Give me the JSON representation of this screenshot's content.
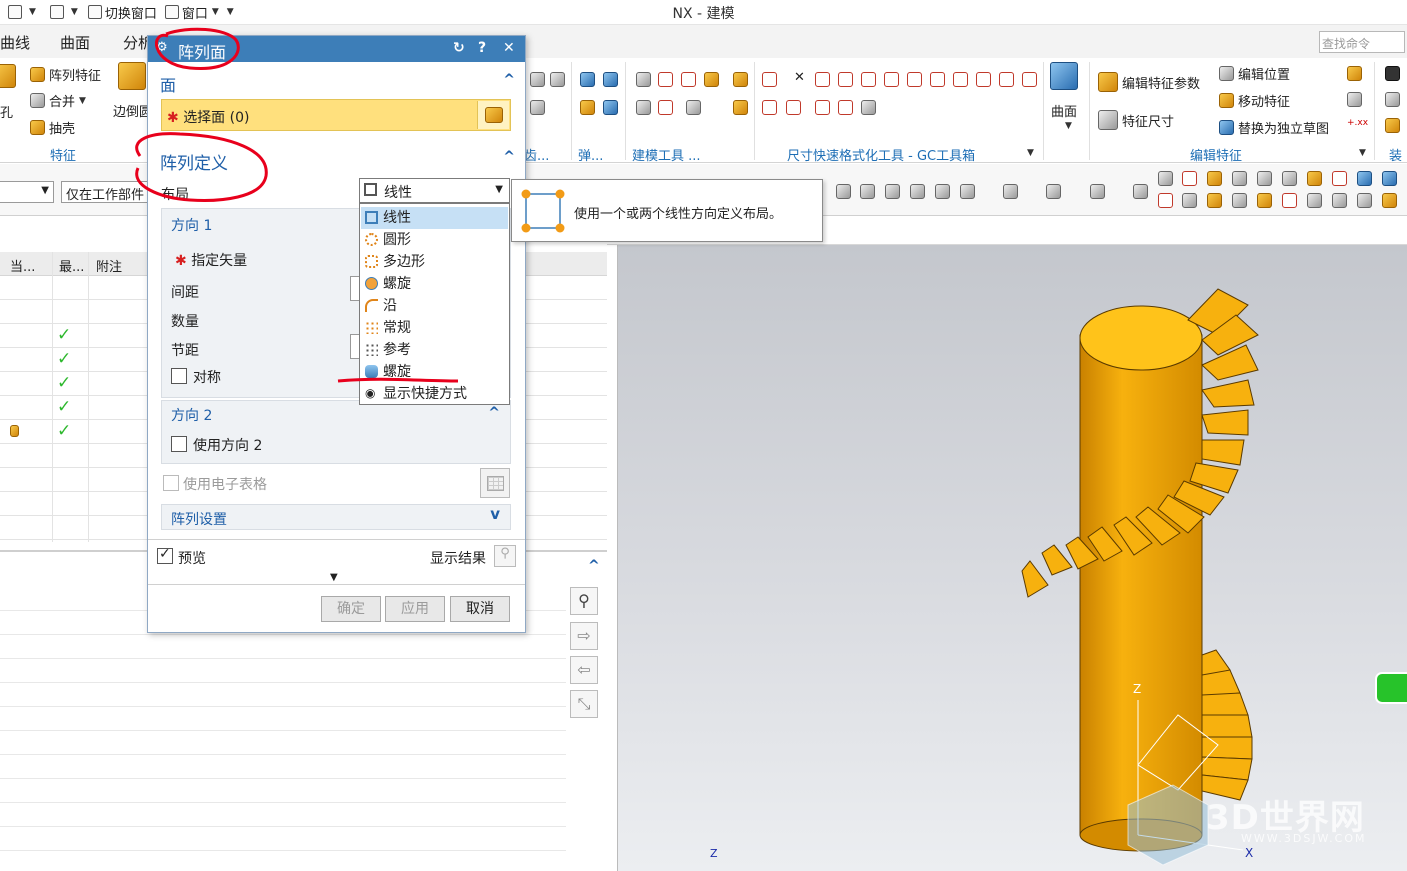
{
  "window": {
    "title": "NX - 建模"
  },
  "quick_access": {
    "switch_window": "切换窗口",
    "window": "窗口"
  },
  "ribbon_tabs": [
    "曲线",
    "曲面",
    "分析"
  ],
  "search": {
    "placeholder": "查找命令"
  },
  "ribbon": {
    "feature_group": {
      "label": "特征",
      "pattern_feature": "阵列特征",
      "unite": "合并",
      "shell": "抽壳",
      "edge_blend": "边倒圆"
    },
    "modeling_tools": "建模工具 ...",
    "dimension_tools": "尺寸快速格式化工具 - GC工具箱",
    "surface": "曲面",
    "edit_feature_group": {
      "label": "编辑特征",
      "edit_params": "编辑特征参数",
      "edit_position": "编辑位置",
      "move_feature": "移动特征",
      "feature_dimension": "特征尺寸",
      "replace_sketch": "替换为独立草图"
    },
    "misc_label_1": "齿...",
    "misc_label_2": "弹...",
    "assembly": "装配"
  },
  "toolbar2": {
    "filter_value": "仅在工作部件"
  },
  "navigator": {
    "columns": [
      "当...",
      "最...",
      "附注"
    ]
  },
  "dialog": {
    "title": "阵列面",
    "section_face": "面",
    "select_face": "选择面 (0)",
    "section_definition": "阵列定义",
    "layout_label": "布局",
    "layout_value": "线性",
    "direction1": "方向 1",
    "specify_vector": "指定矢量",
    "spacing": "间距",
    "count": "数量",
    "pitch": "节距",
    "symmetric": "对称",
    "direction2": "方向 2",
    "use_direction2": "使用方向 2",
    "use_spreadsheet": "使用电子表格",
    "pattern_settings": "阵列设置",
    "preview": "预览",
    "show_result": "显示结果",
    "ok": "确定",
    "apply": "应用",
    "cancel": "取消"
  },
  "layout_options": [
    {
      "label": "线性",
      "icon": "linear-layout-icon"
    },
    {
      "label": "圆形",
      "icon": "circular-layout-icon"
    },
    {
      "label": "多边形",
      "icon": "polygon-layout-icon"
    },
    {
      "label": "螺旋",
      "icon": "spiral-layout-icon"
    },
    {
      "label": "沿",
      "icon": "along-layout-icon"
    },
    {
      "label": "常规",
      "icon": "general-layout-icon"
    },
    {
      "label": "参考",
      "icon": "reference-layout-icon"
    },
    {
      "label": "螺旋",
      "icon": "helix-layout-icon"
    },
    {
      "label": "显示快捷方式",
      "icon": "eye-icon"
    }
  ],
  "tooltip": {
    "text": "使用一个或两个线性方向定义布局。"
  },
  "watermark": {
    "brand": "3D世界网",
    "url": "WWW.3DSJW.COM"
  },
  "axes": {
    "z": "Z",
    "x": "X"
  },
  "colors": {
    "accent": "#3d7eb8",
    "selection": "#ffe07d",
    "model": "#f7b10e",
    "annotation": "#e8001c"
  }
}
